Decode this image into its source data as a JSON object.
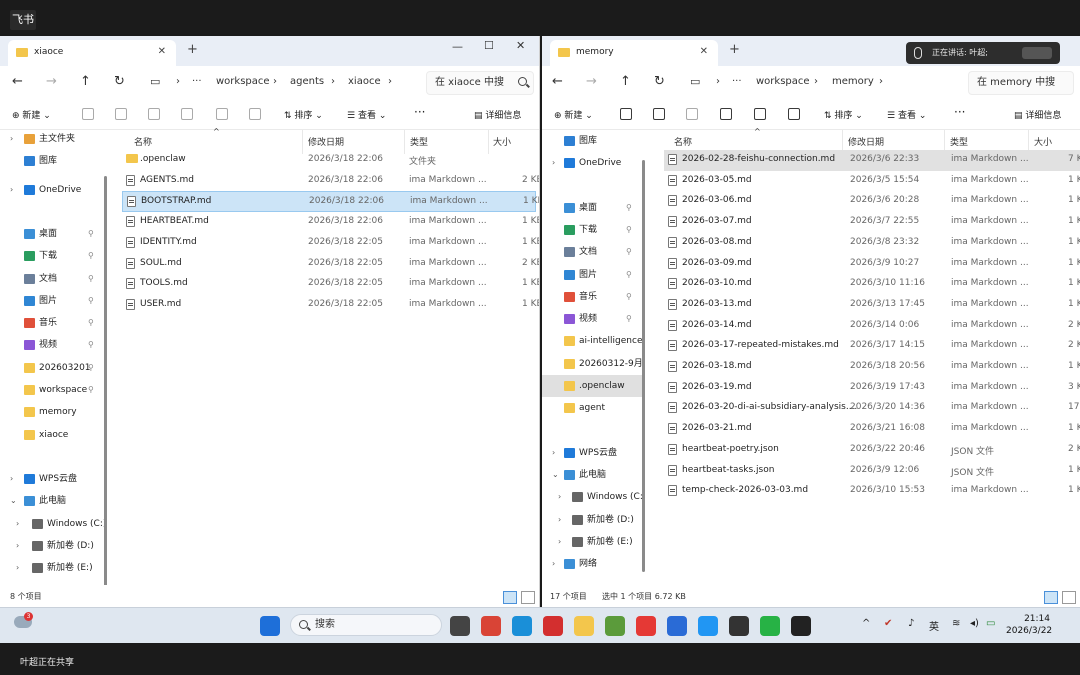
{
  "screen": {
    "app_badge": "飞书",
    "share_text": "正在讲话: 叶超;",
    "footer_text": "叶超正在共享"
  },
  "left": {
    "tab_title": "xiaoce",
    "breadcrumb": [
      "workspace",
      "agents",
      "xiaoce"
    ],
    "search_placeholder": "在 xiaoce 中搜",
    "toolbar": {
      "new": "新建",
      "sort": "排序",
      "view": "查看",
      "details": "详细信息"
    },
    "columns": [
      "名称",
      "修改日期",
      "类型",
      "大小"
    ],
    "nav": [
      {
        "label": "主文件夹",
        "icon": "home-icon",
        "chev": ">"
      },
      {
        "label": "图库",
        "icon": "gallery-icon"
      },
      {
        "label": "OneDrive",
        "icon": "cloud-icon",
        "chev": ">"
      },
      {
        "label": "桌面",
        "icon": "desktop-icon",
        "pin": true
      },
      {
        "label": "下载",
        "icon": "download-icon",
        "pin": true
      },
      {
        "label": "文档",
        "icon": "document-icon",
        "pin": true
      },
      {
        "label": "图片",
        "icon": "picture-icon",
        "pin": true
      },
      {
        "label": "音乐",
        "icon": "music-icon",
        "pin": true
      },
      {
        "label": "视频",
        "icon": "video-icon",
        "pin": true
      },
      {
        "label": "202603201",
        "icon": "folder-icon",
        "pin": true
      },
      {
        "label": "workspace",
        "icon": "folder-icon",
        "pin": true
      },
      {
        "label": "memory",
        "icon": "folder-icon"
      },
      {
        "label": "xiaoce",
        "icon": "folder-icon"
      },
      {
        "label": "WPS云盘",
        "icon": "cloud-icon",
        "chev": ">"
      },
      {
        "label": "此电脑",
        "icon": "pc-icon",
        "chev": "v"
      },
      {
        "label": "Windows (C:)",
        "icon": "drive-icon",
        "chev": ">"
      },
      {
        "label": "新加卷 (D:)",
        "icon": "drive-icon",
        "chev": ">"
      },
      {
        "label": "新加卷 (E:)",
        "icon": "drive-icon",
        "chev": ">"
      }
    ],
    "files": [
      {
        "name": ".openclaw",
        "date": "2026/3/18 22:06",
        "type": "文件夹",
        "size": "",
        "folder": true
      },
      {
        "name": "AGENTS.md",
        "date": "2026/3/18 22:06",
        "type": "ima Markdown ...",
        "size": "2 KB"
      },
      {
        "name": "BOOTSTRAP.md",
        "date": "2026/3/18 22:06",
        "type": "ima Markdown ...",
        "size": "1 KB",
        "selected": true
      },
      {
        "name": "HEARTBEAT.md",
        "date": "2026/3/18 22:06",
        "type": "ima Markdown ...",
        "size": "1 KB"
      },
      {
        "name": "IDENTITY.md",
        "date": "2026/3/18 22:05",
        "type": "ima Markdown ...",
        "size": "1 KB"
      },
      {
        "name": "SOUL.md",
        "date": "2026/3/18 22:05",
        "type": "ima Markdown ...",
        "size": "2 KB"
      },
      {
        "name": "TOOLS.md",
        "date": "2026/3/18 22:05",
        "type": "ima Markdown ...",
        "size": "1 KB"
      },
      {
        "name": "USER.md",
        "date": "2026/3/18 22:05",
        "type": "ima Markdown ...",
        "size": "1 KB"
      }
    ],
    "status": "8 个项目"
  },
  "right": {
    "tab_title": "memory",
    "breadcrumb": [
      "workspace",
      "memory"
    ],
    "search_placeholder": "在 memory 中搜",
    "toolbar": {
      "new": "新建",
      "sort": "排序",
      "view": "查看",
      "details": "详细信息"
    },
    "columns": [
      "名称",
      "修改日期",
      "类型",
      "大小"
    ],
    "nav": [
      {
        "label": "图库",
        "icon": "gallery-icon"
      },
      {
        "label": "OneDrive",
        "icon": "cloud-icon",
        "chev": ">"
      },
      {
        "label": "桌面",
        "icon": "desktop-icon",
        "pin": true
      },
      {
        "label": "下载",
        "icon": "download-icon",
        "pin": true
      },
      {
        "label": "文档",
        "icon": "document-icon",
        "pin": true
      },
      {
        "label": "图片",
        "icon": "picture-icon",
        "pin": true
      },
      {
        "label": "音乐",
        "icon": "music-icon",
        "pin": true
      },
      {
        "label": "视频",
        "icon": "video-icon",
        "pin": true
      },
      {
        "label": "ai-intelligence",
        "icon": "folder-icon"
      },
      {
        "label": "20260312-9月",
        "icon": "folder-icon"
      },
      {
        "label": ".openclaw",
        "icon": "folder-icon",
        "selected": true
      },
      {
        "label": "agent",
        "icon": "folder-icon"
      },
      {
        "label": "WPS云盘",
        "icon": "cloud-icon",
        "chev": ">"
      },
      {
        "label": "此电脑",
        "icon": "pc-icon",
        "chev": "v"
      },
      {
        "label": "Windows (C:)",
        "icon": "drive-icon",
        "chev": ">"
      },
      {
        "label": "新加卷 (D:)",
        "icon": "drive-icon",
        "chev": ">"
      },
      {
        "label": "新加卷 (E:)",
        "icon": "drive-icon",
        "chev": ">"
      },
      {
        "label": "网络",
        "icon": "network-icon",
        "chev": ">"
      }
    ],
    "files": [
      {
        "name": "2026-02-28-feishu-connection.md",
        "date": "2026/3/6 22:33",
        "type": "ima Markdown ...",
        "size": "7 KB",
        "selected": true
      },
      {
        "name": "2026-03-05.md",
        "date": "2026/3/5 15:54",
        "type": "ima Markdown ...",
        "size": "1 KB"
      },
      {
        "name": "2026-03-06.md",
        "date": "2026/3/6 20:28",
        "type": "ima Markdown ...",
        "size": "1 KB"
      },
      {
        "name": "2026-03-07.md",
        "date": "2026/3/7 22:55",
        "type": "ima Markdown ...",
        "size": "1 KB"
      },
      {
        "name": "2026-03-08.md",
        "date": "2026/3/8 23:32",
        "type": "ima Markdown ...",
        "size": "1 KB"
      },
      {
        "name": "2026-03-09.md",
        "date": "2026/3/9 10:27",
        "type": "ima Markdown ...",
        "size": "1 KB"
      },
      {
        "name": "2026-03-10.md",
        "date": "2026/3/10 11:16",
        "type": "ima Markdown ...",
        "size": "1 KB"
      },
      {
        "name": "2026-03-13.md",
        "date": "2026/3/13 17:45",
        "type": "ima Markdown ...",
        "size": "1 KB"
      },
      {
        "name": "2026-03-14.md",
        "date": "2026/3/14 0:06",
        "type": "ima Markdown ...",
        "size": "2 KB"
      },
      {
        "name": "2026-03-17-repeated-mistakes.md",
        "date": "2026/3/17 14:15",
        "type": "ima Markdown ...",
        "size": "2 KB"
      },
      {
        "name": "2026-03-18.md",
        "date": "2026/3/18 20:56",
        "type": "ima Markdown ...",
        "size": "1 KB"
      },
      {
        "name": "2026-03-19.md",
        "date": "2026/3/19 17:43",
        "type": "ima Markdown ...",
        "size": "3 KB"
      },
      {
        "name": "2026-03-20-di-ai-subsidiary-analysis....",
        "date": "2026/3/20 14:36",
        "type": "ima Markdown ...",
        "size": "17 KB"
      },
      {
        "name": "2026-03-21.md",
        "date": "2026/3/21 16:08",
        "type": "ima Markdown ...",
        "size": "1 KB"
      },
      {
        "name": "heartbeat-poetry.json",
        "date": "2026/3/22 20:46",
        "type": "JSON 文件",
        "size": "2 KB"
      },
      {
        "name": "heartbeat-tasks.json",
        "date": "2026/3/9 12:06",
        "type": "JSON 文件",
        "size": "1 KB"
      },
      {
        "name": "temp-check-2026-03-03.md",
        "date": "2026/3/10 15:53",
        "type": "ima Markdown ...",
        "size": "1 KB"
      }
    ],
    "status_count": "17 个项目",
    "status_selection": "选中 1 个项目  6.72 KB"
  },
  "taskbar": {
    "weather_badge": "3",
    "search": "搜索",
    "ime": "英",
    "time": "21:14",
    "date": "2026/3/22",
    "apps": [
      "task-view",
      "chrome",
      "edge",
      "wps",
      "explorer",
      "notes",
      "so",
      "feishu",
      "lark-docs",
      "terminal",
      "wechat",
      "panda"
    ]
  },
  "colors": {
    "selection": "#cce4f7",
    "accent": "#0067c0",
    "folder": "#f3c64c"
  }
}
